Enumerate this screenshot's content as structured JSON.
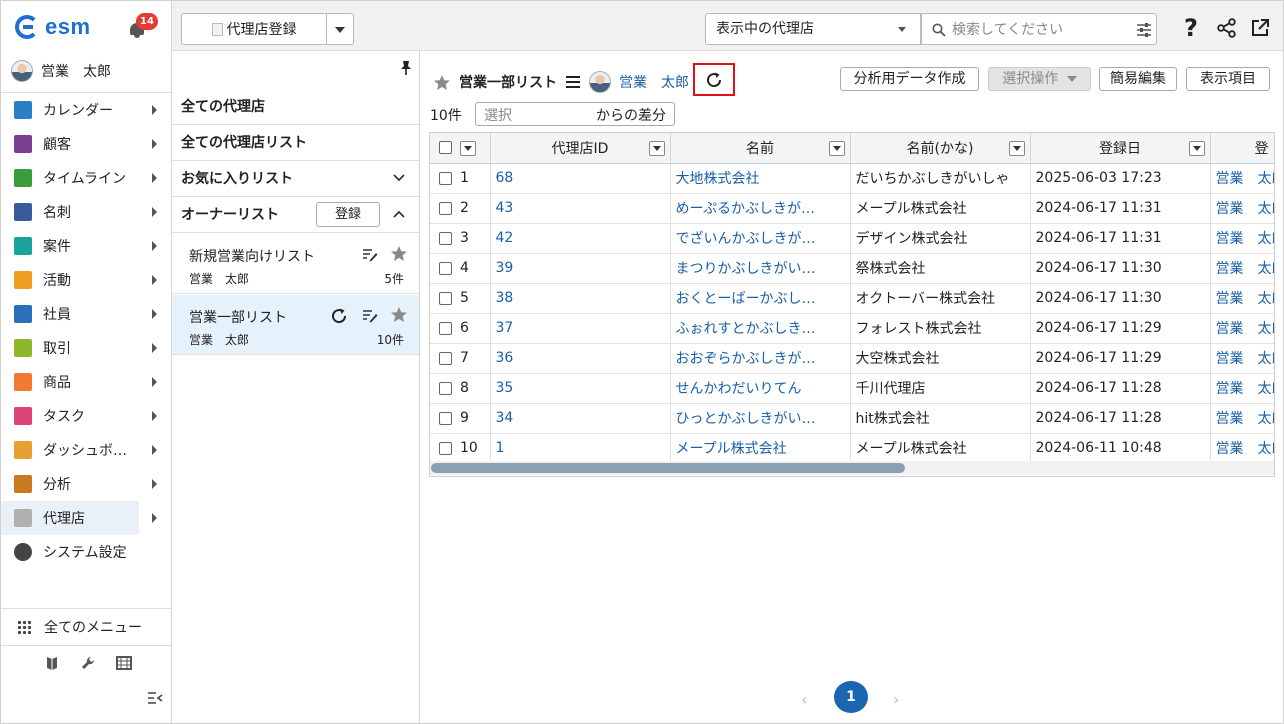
{
  "brand": {
    "name": "esm",
    "color": "#1e6fd0"
  },
  "notifications": {
    "count": "14",
    "icon": "bell-icon"
  },
  "user": {
    "name": "営業　太郎"
  },
  "nav": {
    "items": [
      {
        "label": "カレンダー",
        "icon": "calendar-icon",
        "color": "#2a7fc7"
      },
      {
        "label": "顧客",
        "icon": "building-icon",
        "color": "#7b3f8f"
      },
      {
        "label": "タイムライン",
        "icon": "chat-icon",
        "color": "#3a9c3a"
      },
      {
        "label": "名刺",
        "icon": "card-icon",
        "color": "#3a5a99"
      },
      {
        "label": "案件",
        "icon": "folder-icon",
        "color": "#19a39a"
      },
      {
        "label": "活動",
        "icon": "clipboard-icon",
        "color": "#f0a020"
      },
      {
        "label": "社員",
        "icon": "person-icon",
        "color": "#2a6fb8"
      },
      {
        "label": "取引",
        "icon": "ledger-icon",
        "color": "#8db82a"
      },
      {
        "label": "商品",
        "icon": "box-icon",
        "color": "#f07a30"
      },
      {
        "label": "タスク",
        "icon": "check-icon",
        "color": "#e0407a"
      },
      {
        "label": "ダッシュボ…",
        "icon": "dashboard-icon",
        "color": "#e8a030"
      },
      {
        "label": "分析",
        "icon": "chart-icon",
        "color": "#c87a20"
      },
      {
        "label": "代理店",
        "icon": "document-icon",
        "color": "#b0b0b0"
      },
      {
        "label": "システム設定",
        "icon": "gear-icon",
        "color": "#444444"
      }
    ],
    "all_menu": "全てのメニュー"
  },
  "topbar": {
    "register_label": "代理店登録",
    "scope_label": "表示中の代理店",
    "search_placeholder": "検索してください",
    "help_label": "?"
  },
  "listpanel": {
    "all_agencies": "全ての代理店",
    "all_lists": "全ての代理店リスト",
    "favorites": "お気に入りリスト",
    "owner_lists": "オーナーリスト",
    "register_button": "登録",
    "lists": [
      {
        "name": "新規営業向けリスト",
        "owner": "営業　太郎",
        "count": "5件"
      },
      {
        "name": "営業一部リスト",
        "owner": "営業　太郎",
        "count": "10件"
      }
    ]
  },
  "main": {
    "list_title": "営業一部リスト",
    "owner": "営業　太郎",
    "buttons": {
      "analysis": "分析用データ作成",
      "select_ops": "選択操作",
      "quick_edit": "簡易編集",
      "display_items": "表示項目"
    },
    "count": "10件",
    "diff_placeholder": "選択",
    "diff_label": "からの差分",
    "highlight_color": "#e0101a"
  },
  "table": {
    "columns": [
      "代理店ID",
      "名前",
      "名前(かな)",
      "登録日",
      "登"
    ],
    "rows": [
      {
        "n": "1",
        "id": "68",
        "name": "大地株式会社",
        "kana": "だいちかぶしきがいしゃ",
        "date": "2025-06-03 17:23",
        "by": "営業　太郎"
      },
      {
        "n": "2",
        "id": "43",
        "name": "めーぷるかぶしきが…",
        "kana": "メープル株式会社",
        "date": "2024-06-17 11:31",
        "by": "営業　太郎"
      },
      {
        "n": "3",
        "id": "42",
        "name": "でざいんかぶしきが…",
        "kana": "デザイン株式会社",
        "date": "2024-06-17 11:31",
        "by": "営業　太郎"
      },
      {
        "n": "4",
        "id": "39",
        "name": "まつりかぶしきがい…",
        "kana": "祭株式会社",
        "date": "2024-06-17 11:30",
        "by": "営業　太郎"
      },
      {
        "n": "5",
        "id": "38",
        "name": "おくとーばーかぶし…",
        "kana": "オクトーバー株式会社",
        "date": "2024-06-17 11:30",
        "by": "営業　太郎"
      },
      {
        "n": "6",
        "id": "37",
        "name": "ふぉれすとかぶしき…",
        "kana": "フォレスト株式会社",
        "date": "2024-06-17 11:29",
        "by": "営業　太郎"
      },
      {
        "n": "7",
        "id": "36",
        "name": "おおぞらかぶしきが…",
        "kana": "大空株式会社",
        "date": "2024-06-17 11:29",
        "by": "営業　太郎"
      },
      {
        "n": "8",
        "id": "35",
        "name": "せんかわだいりてん",
        "kana": "千川代理店",
        "date": "2024-06-17 11:28",
        "by": "営業　太郎"
      },
      {
        "n": "9",
        "id": "34",
        "name": "ひっとかぶしきがい…",
        "kana": "hit株式会社",
        "date": "2024-06-17 11:28",
        "by": "営業　太郎"
      },
      {
        "n": "10",
        "id": "1",
        "name": "メープル株式会社",
        "kana": "メープル株式会社",
        "date": "2024-06-11 10:48",
        "by": "営業　太郎"
      }
    ]
  },
  "pagination": {
    "current": "1",
    "prev": "‹",
    "next": "›"
  }
}
